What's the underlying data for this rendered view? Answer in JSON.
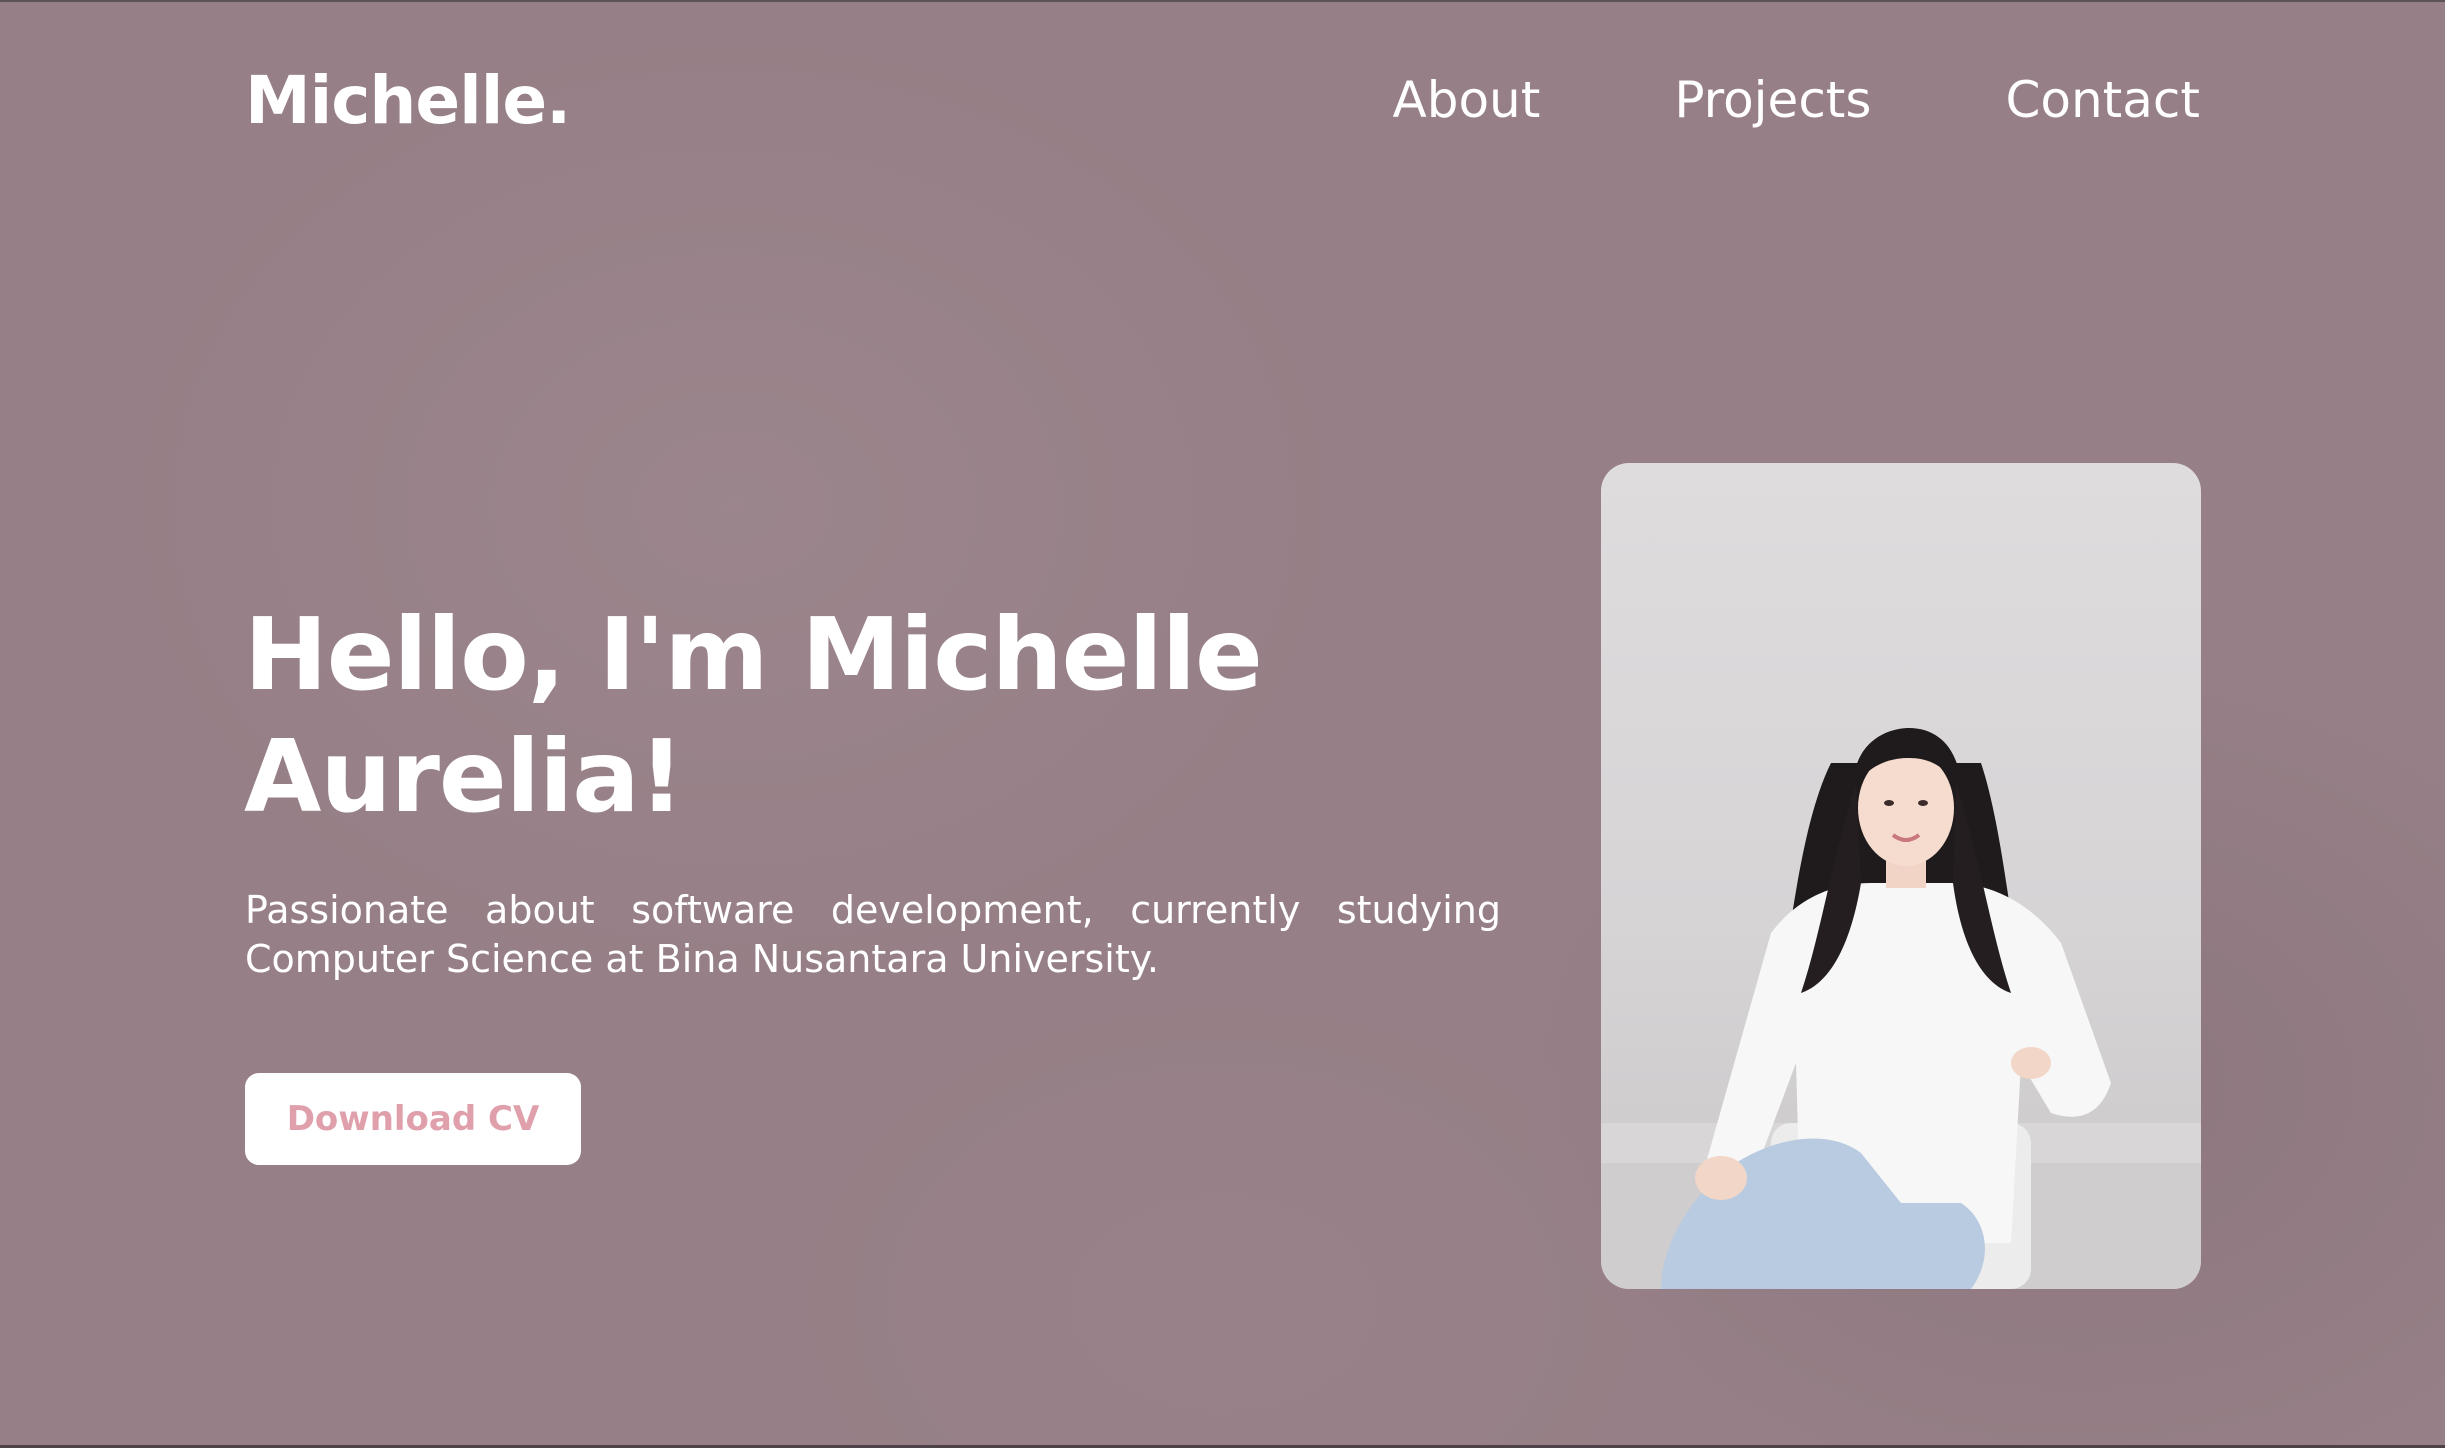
{
  "header": {
    "logo": "Michelle.",
    "nav": [
      {
        "label": "About"
      },
      {
        "label": "Projects"
      },
      {
        "label": "Contact"
      }
    ]
  },
  "hero": {
    "title_line1": "Hello, I'm Michelle",
    "title_line2": "Aurelia!",
    "description": "Passionate about software development, currently studying Computer Science at Bina Nusantara University.",
    "cta_label": "Download CV"
  },
  "colors": {
    "background": "#967f86",
    "text": "#ffffff",
    "button_background": "#ffffff",
    "button_text": "#e0a0ab"
  },
  "icons": {
    "portrait": "profile-photo"
  }
}
